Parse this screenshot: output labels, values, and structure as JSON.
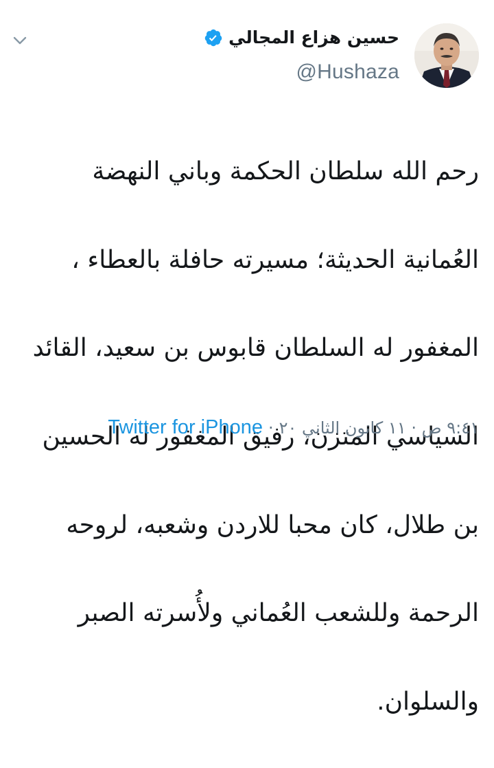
{
  "author": {
    "name": "حسين هزاع المجالي",
    "handle": "@Hushaza",
    "verified": true,
    "verified_color": "#1da1f2"
  },
  "tweet": {
    "lines": [
      "رحم الله سلطان الحكمة وباني النهضة",
      "العُمانية الحديثة؛ مسيرته حافلة بالعطاء ،",
      "المغفور له السلطان قابوس بن سعيد، القائد",
      "السياسي المتزن، رفيق المغفور له الحسين",
      "بن طلال، كان محبا للاردن وشعبه، لروحه",
      "الرحمة وللشعب العُماني ولأُسرته الصبر",
      "والسلوان."
    ]
  },
  "meta": {
    "time": "٩:٤١ ص · ١١ كانون الثاني ٢٠",
    "separator": "·",
    "source": "Twitter for iPhone"
  },
  "icons": {
    "menu": "chevron-down-icon",
    "verified": "verified-badge-icon"
  },
  "colors": {
    "link": "#1b95e0",
    "muted": "#657786",
    "text": "#14171a"
  }
}
